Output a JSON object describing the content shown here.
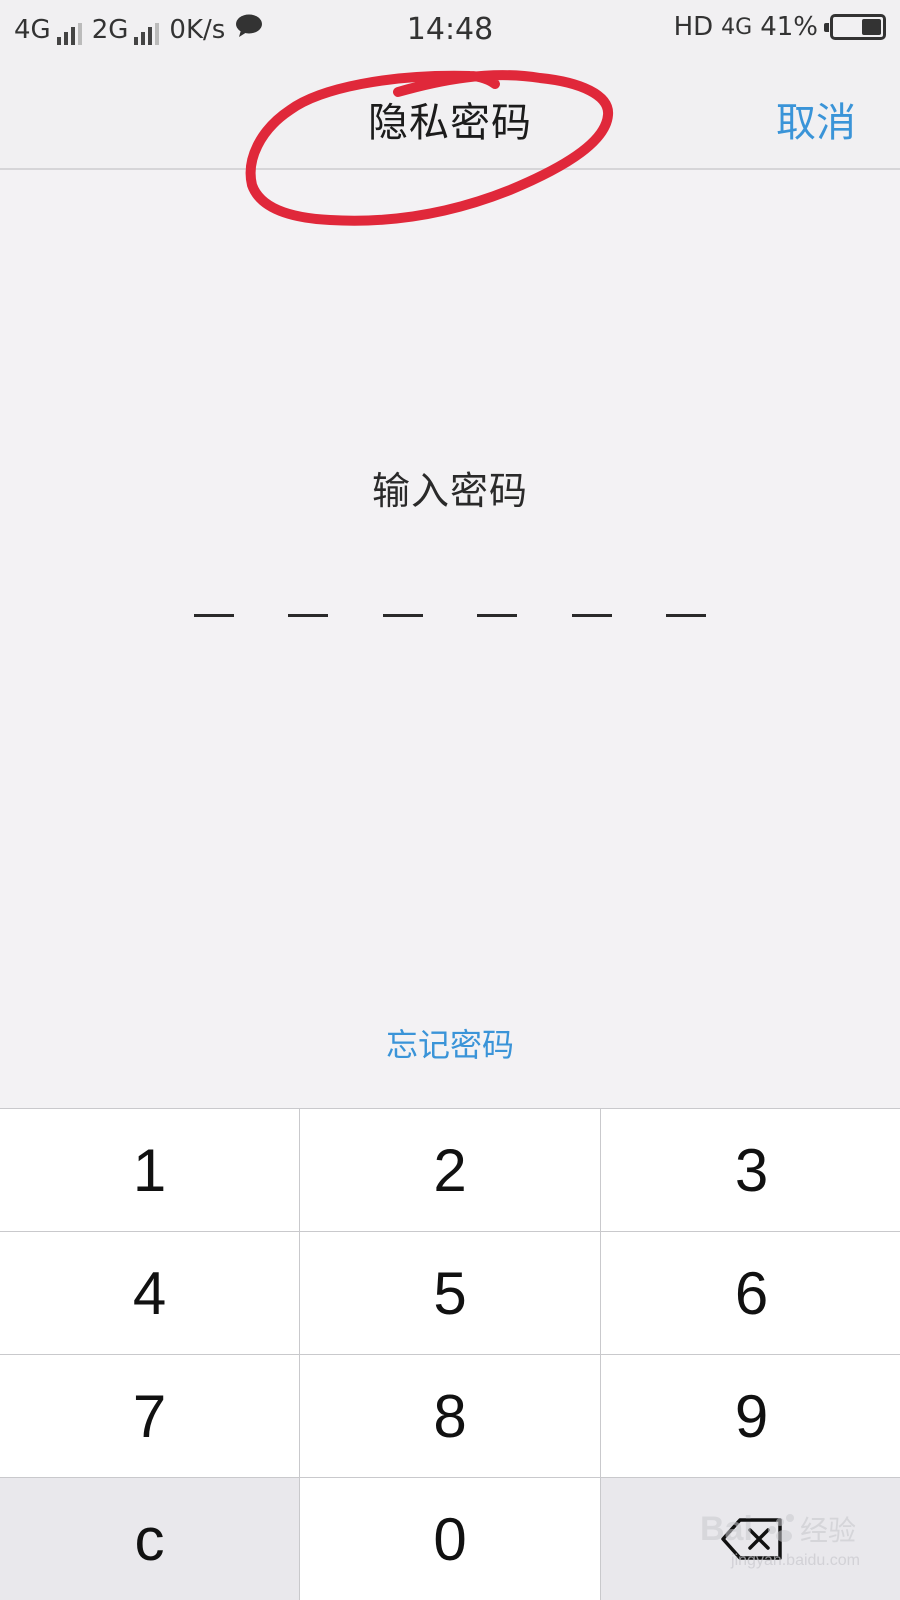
{
  "status_bar": {
    "network1": "4G",
    "network2": "2G",
    "speed": "0K/s",
    "time": "14:48",
    "hd": "HD",
    "network3": "4G",
    "battery": "41%",
    "battery_level": 0.41
  },
  "nav": {
    "title": "隐私密码",
    "cancel": "取消"
  },
  "content": {
    "prompt": "输入密码",
    "pin_length": 6,
    "forgot": "忘记密码"
  },
  "keypad": {
    "keys": [
      "1",
      "2",
      "3",
      "4",
      "5",
      "6",
      "7",
      "8",
      "9",
      "c",
      "0"
    ],
    "backspace_icon": "backspace-icon"
  },
  "watermark": {
    "url": "jingyan.baidu.com"
  },
  "colors": {
    "accent": "#3a94d8",
    "annotation": "#e0283a",
    "background": "#f3f2f4"
  }
}
